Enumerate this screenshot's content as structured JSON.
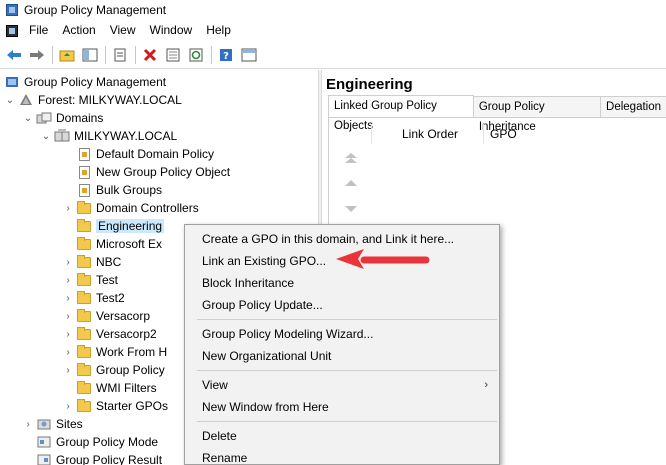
{
  "window": {
    "title": "Group Policy Management"
  },
  "menubar": {
    "items": [
      "File",
      "Action",
      "View",
      "Window",
      "Help"
    ]
  },
  "toolbar": {
    "buttons": [
      "back-icon",
      "forward-icon",
      "folder-up-icon",
      "show-tree-icon",
      "properties-icon",
      "delete-icon",
      "export-icon",
      "refresh-icon",
      "help-icon",
      "console-icon"
    ]
  },
  "tree": {
    "root": "Group Policy Management",
    "forest": "Forest: MILKYWAY.LOCAL",
    "domains": "Domains",
    "domain": "MILKYWAY.LOCAL",
    "children": [
      "Default Domain Policy",
      "New Group Policy Object",
      "Bulk Groups",
      "Domain Controllers",
      "Engineering",
      "Microsoft Ex",
      "NBC",
      "Test",
      "Test2",
      "Versacorp",
      "Versacorp2",
      "Work From H",
      "Group Policy",
      "WMI Filters",
      "Starter GPOs"
    ],
    "sites": "Sites",
    "modeling": "Group Policy Mode",
    "results": "Group Policy Result"
  },
  "details": {
    "title": "Engineering",
    "tabs": [
      "Linked Group Policy Objects",
      "Group Policy Inheritance",
      "Delegation"
    ],
    "columns": {
      "link_order": "Link Order",
      "gpo": "GPO"
    }
  },
  "context_menu": {
    "items": [
      "Create a GPO in this domain, and Link it here...",
      "Link an Existing GPO...",
      "Block Inheritance",
      "Group Policy Update...",
      "Group Policy Modeling Wizard...",
      "New Organizational Unit",
      "View",
      "New Window from Here",
      "Delete",
      "Rename"
    ],
    "submenu_arrow": "›"
  },
  "colors": {
    "selection": "#cce8ff",
    "annotation_arrow": "#e8343a",
    "folder": "#f2c94c"
  }
}
